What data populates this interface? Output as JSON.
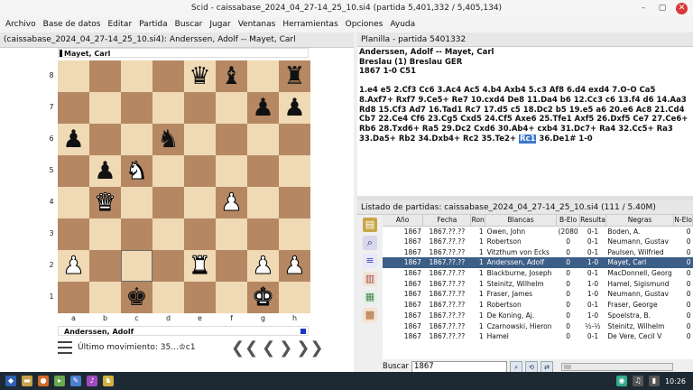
{
  "window": {
    "title": "Scid - caissabase_2024_04_27-14_25_10.si4 (partida 5,401,332 / 5,405,134)",
    "buttons": [
      "–",
      "▢",
      "✕"
    ]
  },
  "menu": [
    "Archivo",
    "Base de datos",
    "Editar",
    "Partida",
    "Buscar",
    "Jugar",
    "Ventanas",
    "Herramientas",
    "Opciones",
    "Ayuda"
  ],
  "board_panel": {
    "header": "(caissabase_2024_04_27-14_25_10.si4): Anderssen, Adolf -- Mayet, Carl",
    "top_player": "Mayet, Carl",
    "bottom_player": "Anderssen, Adolf",
    "ranks": [
      "8",
      "7",
      "6",
      "5",
      "4",
      "3",
      "2",
      "1"
    ],
    "files": [
      "a",
      "b",
      "c",
      "d",
      "e",
      "f",
      "g",
      "h"
    ],
    "last_move": "Último movimiento: 35...♔c1",
    "nav": [
      "❮❮",
      "❮",
      "❯",
      "❯❯"
    ],
    "position": [
      [
        "",
        "",
        "",
        "",
        "bq",
        "bb",
        "",
        "br"
      ],
      [
        "",
        "",
        "",
        "",
        "",
        "",
        "bp",
        "bp"
      ],
      [
        "bp",
        "",
        "",
        "bn",
        "",
        "",
        "",
        ""
      ],
      [
        "",
        "bp",
        "wn",
        "",
        "",
        "",
        "",
        ""
      ],
      [
        "",
        "wq",
        "",
        "",
        "",
        "wp",
        "",
        ""
      ],
      [
        "",
        "",
        "",
        "",
        "",
        "",
        "",
        ""
      ],
      [
        "wp",
        "",
        "",
        "",
        "wr",
        "",
        "wp",
        "wp"
      ],
      [
        "",
        "",
        "bk",
        "",
        "",
        "",
        "wk",
        ""
      ]
    ],
    "last_move_square": [
      6,
      2
    ]
  },
  "notation": {
    "header": "Planilla - partida 5401332",
    "players": "Anderssen, Adolf  --  Mayet, Carl",
    "event": "Breslau (1)  Breslau GER",
    "info": "1867  1-0  C51",
    "moves_before": "1.e4 e5 2.Cf3 Cc6 3.Ac4 Ac5 4.b4 Axb4 5.c3 Af8 6.d4 exd4 7.O-O Ca5 8.Axf7+ Rxf7 9.Ce5+ Re7 10.cxd4 De8 11.Da4 b6 12.Cc3 c6 13.f4 d6 14.Aa3 Rd8 15.Cf3 Ad7 16.Tad1 Rc7 17.d5 c5 18.Dc2 b5 19.e5 a6 20.e6 Ac8 21.Cd4 Cb7 22.Ce4 Cf6 23.Cg5 Cxd5 24.Cf5 Axe6 25.Tfe1 Axf5 26.Dxf5 Ce7 27.Ce6+ Rb6 28.Txd6+ Ra5 29.Dc2 Cxd6 30.Ab4+ cxb4 31.Dc7+ Ra4 32.Cc5+ Ra3 33.Da5+ Rb2 34.Dxb4+ Rc2 35.Te2+ ",
    "current_move": "Rc1",
    "moves_after": " 36.De1# 1-0"
  },
  "game_list": {
    "header": "Listado de partidas: caissabase_2024_04_27-14_25_10.si4 (111 / 5.40M)",
    "columns": [
      "Año",
      "Fecha",
      "Ron",
      "Blancas",
      "B-Elo",
      "Resulta",
      "Negras",
      "N-Elo"
    ],
    "rows": [
      [
        "1867",
        "1867.??.??",
        "1",
        "Owen, John",
        "(2080",
        "0-1",
        "Boden, A.",
        "0"
      ],
      [
        "1867",
        "1867.??.??",
        "1",
        "Robertson",
        "0",
        "0-1",
        "Neumann, Gustav",
        "0"
      ],
      [
        "1867",
        "1867.??.??",
        "1",
        "Vitzthum von Ecks",
        "0",
        "0-1",
        "Paulsen, Wilfried",
        "0"
      ],
      [
        "1867",
        "1867.??.??",
        "1",
        "Anderssen, Adolf",
        "0",
        "1-0",
        "Mayet, Carl",
        "0"
      ],
      [
        "1867",
        "1867.??.??",
        "1",
        "Blackburne, Joseph",
        "0",
        "0-1",
        "MacDonnell, Georg",
        "0"
      ],
      [
        "1867",
        "1867.??.??",
        "1",
        "Steinitz, Wilhelm",
        "0",
        "1-0",
        "Hamel, Sigismund",
        "0"
      ],
      [
        "1867",
        "1867.??.??",
        "1",
        "Fraser, James",
        "0",
        "1-0",
        "Neumann, Gustav",
        "0"
      ],
      [
        "1867",
        "1867.??.??",
        "1",
        "Robertson",
        "0",
        "0-1",
        "Fraser, George",
        "0"
      ],
      [
        "1867",
        "1867.??.??",
        "1",
        "De Koning, Aj.",
        "0",
        "1-0",
        "Spoelstra, B.",
        "0"
      ],
      [
        "1867",
        "1867.??.??",
        "1",
        "Czarnowski, Hieron",
        "0",
        "½-½",
        "Steinitz, Wilhelm",
        "0"
      ],
      [
        "1867",
        "1867.??.??",
        "1",
        "Hamel",
        "0",
        "0-1",
        "De Vere, Cecil V",
        "0"
      ]
    ],
    "selected_index": 3,
    "search_label": "Buscar",
    "search_value": "1867"
  },
  "taskbar": {
    "time": "10:26"
  }
}
